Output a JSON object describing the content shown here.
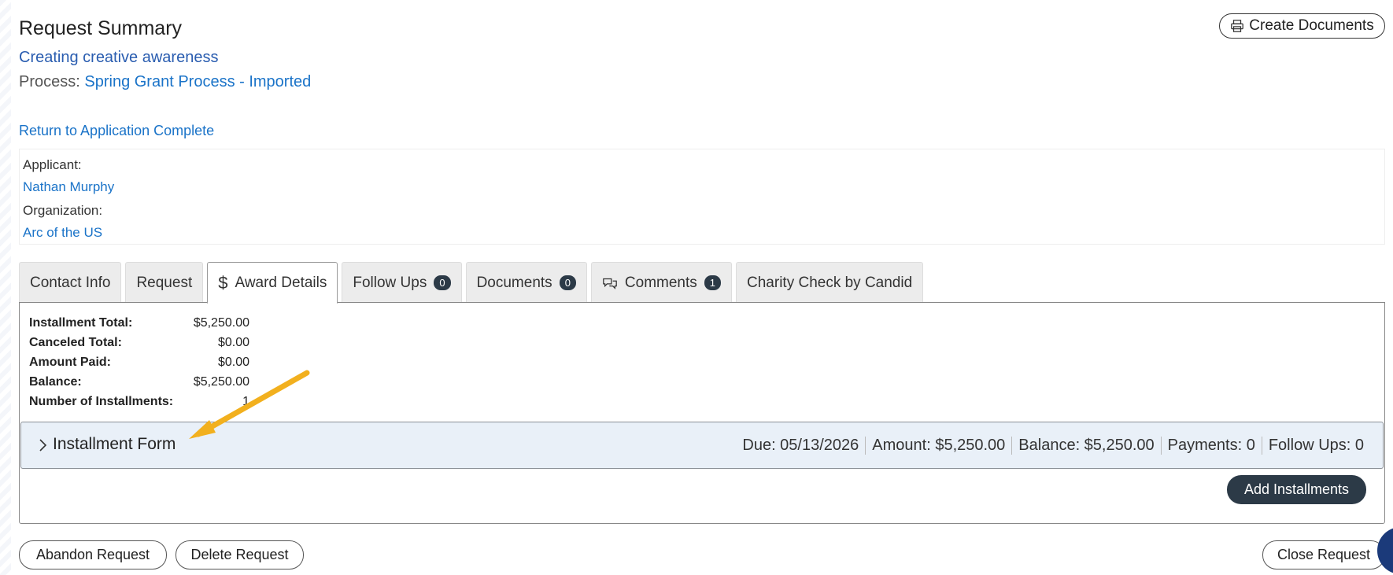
{
  "header": {
    "title": "Request Summary",
    "subtitle": "Creating creative awareness",
    "process_label": "Process:",
    "process_name": "Spring Grant Process - Imported",
    "create_documents": "Create Documents"
  },
  "return_link": "Return to Application Complete",
  "applicant": {
    "applicant_label": "Applicant:",
    "applicant_name": "Nathan Murphy",
    "organization_label": "Organization:",
    "organization_name": "Arc of the US"
  },
  "tabs": [
    {
      "label": "Contact Info"
    },
    {
      "label": "Request"
    },
    {
      "label": "Award Details",
      "icon": "dollar-icon",
      "active": true
    },
    {
      "label": "Follow Ups",
      "badge": "0"
    },
    {
      "label": "Documents",
      "badge": "0"
    },
    {
      "label": "Comments",
      "badge": "1",
      "icon": "comments-icon"
    },
    {
      "label": "Charity Check by Candid"
    }
  ],
  "award_summary": [
    {
      "label": "Installment Total:",
      "value": "$5,250.00"
    },
    {
      "label": "Canceled Total:",
      "value": "$0.00"
    },
    {
      "label": "Amount Paid:",
      "value": "$0.00"
    },
    {
      "label": "Balance:",
      "value": "$5,250.00"
    },
    {
      "label": "Number of Installments:",
      "value": "1"
    }
  ],
  "installment": {
    "title": "Installment Form",
    "due": "Due: 05/13/2026",
    "amount": "Amount: $5,250.00",
    "balance": "Balance: $5,250.00",
    "payments": "Payments: 0",
    "follow_ups": "Follow Ups: 0"
  },
  "buttons": {
    "add_installments": "Add Installments",
    "abandon": "Abandon Request",
    "delete": "Delete Request",
    "close": "Close Request"
  },
  "colors": {
    "link": "#1a73c8",
    "dark_button": "#2c3a47",
    "installment_bg": "#e9f0f8",
    "arrow": "#f2b01e"
  }
}
